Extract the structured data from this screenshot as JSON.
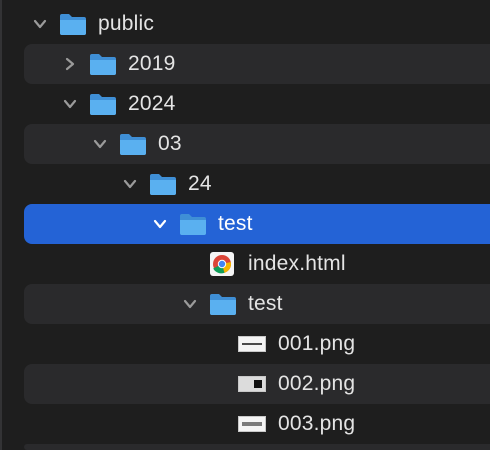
{
  "tree": {
    "items": [
      {
        "label": "public",
        "kind": "folder",
        "expanded": true,
        "depth": 0
      },
      {
        "label": "2019",
        "kind": "folder",
        "expanded": false,
        "depth": 1
      },
      {
        "label": "2024",
        "kind": "folder",
        "expanded": true,
        "depth": 1
      },
      {
        "label": "03",
        "kind": "folder",
        "expanded": true,
        "depth": 2
      },
      {
        "label": "24",
        "kind": "folder",
        "expanded": true,
        "depth": 3
      },
      {
        "label": "test",
        "kind": "folder",
        "expanded": true,
        "depth": 4,
        "selected": true
      },
      {
        "label": "index.html",
        "kind": "file",
        "icon": "chrome-icon",
        "depth": 5
      },
      {
        "label": "test",
        "kind": "folder",
        "expanded": true,
        "depth": 5
      },
      {
        "label": "001.png",
        "kind": "file",
        "icon": "image-thumbnail-icon",
        "depth": 6
      },
      {
        "label": "002.png",
        "kind": "file",
        "icon": "image-thumbnail-icon",
        "depth": 6
      },
      {
        "label": "003.png",
        "kind": "file",
        "icon": "image-thumbnail-icon",
        "depth": 6
      }
    ]
  },
  "colors": {
    "background": "#1e1e1e",
    "row_alt": "#2a2a2c",
    "selection": "#2463d6",
    "folder": "#5ab0f0",
    "text": "#e4e4e4"
  }
}
